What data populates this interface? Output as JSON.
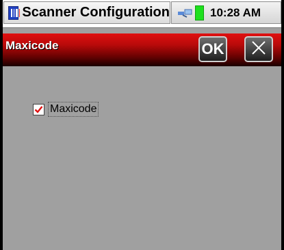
{
  "taskbar": {
    "window_title": "Scanner Configuration",
    "clock": "10:28 AM",
    "icons": [
      "app-icon",
      "connection-icon",
      "battery-icon"
    ]
  },
  "header": {
    "title": "Maxicode",
    "ok_label": "OK",
    "close_icon": "close-icon",
    "colors": {
      "top": "#e01010",
      "bottom": "#1a0000"
    }
  },
  "form": {
    "maxicode_checkbox": {
      "label": "Maxicode",
      "checked": true,
      "check_color": "#e01010"
    }
  },
  "colors": {
    "background": "#a0a0a0",
    "battery": "#1ee01e"
  }
}
